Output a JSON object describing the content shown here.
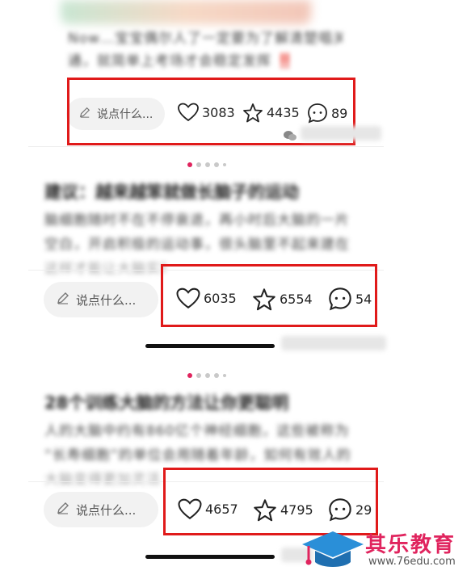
{
  "posts": [
    {
      "title": "",
      "body_lines": [
        "Now…宝宝偶尔人了一定要为了解清楚唱关直",
        "通，就简单上考场才会稳定发挥 ‼️"
      ],
      "comment_placeholder": "说点什么...",
      "likes": "3083",
      "favorites": "4435",
      "comments": "89"
    },
    {
      "title": "建议：越来越笨就做长脑子的运动",
      "body_lines": [
        "脑细胞随时不在不停衰退，再小时后大脑的一片",
        "空白，开启积极的运动事，很头脑里不起来建在",
        "这样才能让大脑实现更加灵活"
      ],
      "comment_placeholder": "说点什么...",
      "likes": "6035",
      "favorites": "6554",
      "comments": "54"
    },
    {
      "title": "28个训练大脑的方法让你更聪明",
      "body_lines": [
        "人的大脑中约有860亿个神经细胞，这些被称为",
        "“长寿细胞”的单位会用随着年龄，如何有效人的",
        "大脑变得更加灵活"
      ],
      "comment_placeholder": "说点什么...",
      "likes": "4657",
      "favorites": "4795",
      "comments": "29"
    }
  ],
  "watermark": {
    "title": "其乐教育",
    "url": "www.76edu.com"
  },
  "colors": {
    "highlight_box": "#e01a1a",
    "active_dot": "#e0245e",
    "brand_blue": "#2a8fd8",
    "brand_pink": "#e0245e"
  },
  "icons": [
    "heart-icon",
    "star-icon",
    "comment-bubble-icon",
    "pencil-icon",
    "wechat-icon",
    "graduation-cap-icon"
  ]
}
